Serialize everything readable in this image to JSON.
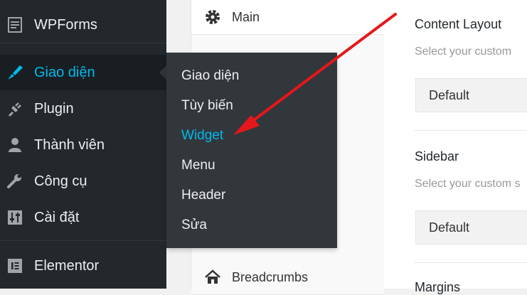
{
  "sidebar": {
    "items": [
      {
        "label": "WPForms",
        "icon": "wpforms-icon"
      },
      {
        "label": "Giao diện",
        "icon": "paintbrush-icon"
      },
      {
        "label": "Plugin",
        "icon": "plugin-icon"
      },
      {
        "label": "Thành viên",
        "icon": "user-icon"
      },
      {
        "label": "Công cụ",
        "icon": "wrench-icon"
      },
      {
        "label": "Cài đặt",
        "icon": "settings-sliders-icon"
      },
      {
        "label": "Elementor",
        "icon": "elementor-icon"
      }
    ]
  },
  "submenu": {
    "items": [
      {
        "label": "Giao diện"
      },
      {
        "label": "Tùy biến"
      },
      {
        "label": "Widget"
      },
      {
        "label": "Menu"
      },
      {
        "label": "Header"
      },
      {
        "label": "Sửa"
      }
    ]
  },
  "tabs": {
    "items": [
      {
        "label": "Main",
        "icon": "gear-icon"
      },
      {
        "label": "Breadcrumbs",
        "icon": "home-icon"
      }
    ]
  },
  "panel": {
    "content_layout": {
      "title": "Content Layout",
      "desc": "Select your custom",
      "value": "Default"
    },
    "sidebar": {
      "title": "Sidebar",
      "desc": "Select your custom s",
      "value": "Default"
    },
    "margins": {
      "title": "Margins"
    }
  },
  "colors": {
    "sidebar_bg": "#23282d",
    "submenu_bg": "#32373c",
    "accent": "#00b9eb",
    "annotation_arrow": "#e5171b"
  }
}
